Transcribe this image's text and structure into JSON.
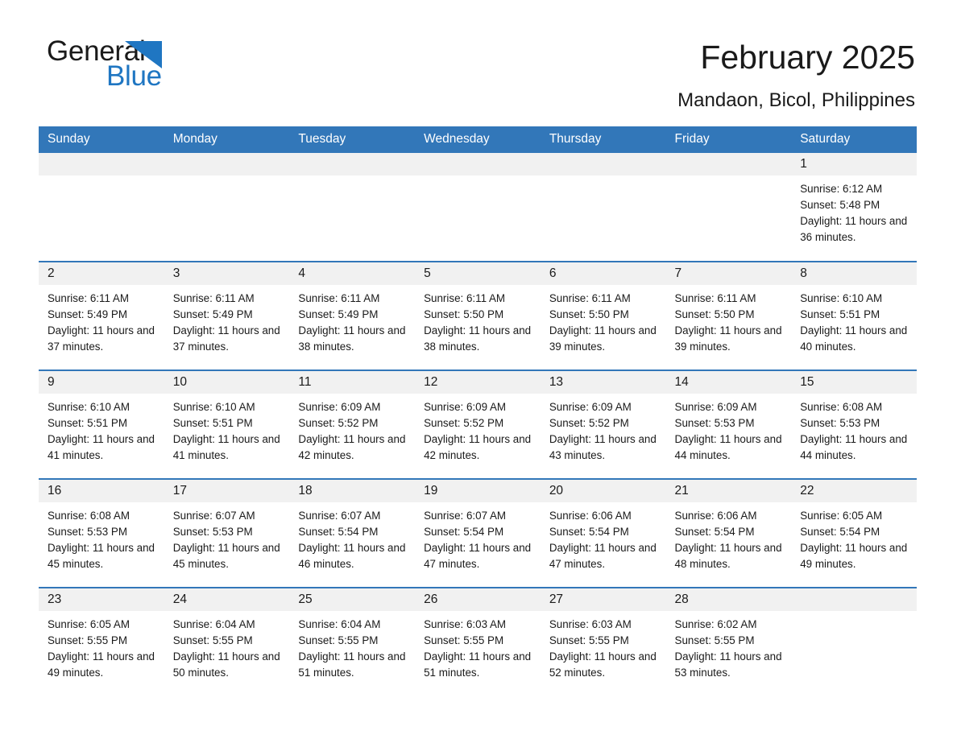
{
  "brand": {
    "name_part1": "General",
    "name_part2": "Blue",
    "logo_icon": "triangle-flag-icon",
    "accent_color": "#1f76c2"
  },
  "header": {
    "title": "February 2025",
    "subtitle": "Mandaon, Bicol, Philippines"
  },
  "theme": {
    "header_blue": "#3277b9",
    "daynum_band": "#f1f1f1",
    "text": "#1a1a1a"
  },
  "calendar": {
    "weekday_headers": [
      "Sunday",
      "Monday",
      "Tuesday",
      "Wednesday",
      "Thursday",
      "Friday",
      "Saturday"
    ],
    "weeks": [
      [
        {
          "day": "",
          "empty": true,
          "sunrise": "",
          "sunset": "",
          "daylight": ""
        },
        {
          "day": "",
          "empty": true,
          "sunrise": "",
          "sunset": "",
          "daylight": ""
        },
        {
          "day": "",
          "empty": true,
          "sunrise": "",
          "sunset": "",
          "daylight": ""
        },
        {
          "day": "",
          "empty": true,
          "sunrise": "",
          "sunset": "",
          "daylight": ""
        },
        {
          "day": "",
          "empty": true,
          "sunrise": "",
          "sunset": "",
          "daylight": ""
        },
        {
          "day": "",
          "empty": true,
          "sunrise": "",
          "sunset": "",
          "daylight": ""
        },
        {
          "day": "1",
          "empty": false,
          "sunrise": "Sunrise: 6:12 AM",
          "sunset": "Sunset: 5:48 PM",
          "daylight": "Daylight: 11 hours and 36 minutes."
        }
      ],
      [
        {
          "day": "2",
          "empty": false,
          "sunrise": "Sunrise: 6:11 AM",
          "sunset": "Sunset: 5:49 PM",
          "daylight": "Daylight: 11 hours and 37 minutes."
        },
        {
          "day": "3",
          "empty": false,
          "sunrise": "Sunrise: 6:11 AM",
          "sunset": "Sunset: 5:49 PM",
          "daylight": "Daylight: 11 hours and 37 minutes."
        },
        {
          "day": "4",
          "empty": false,
          "sunrise": "Sunrise: 6:11 AM",
          "sunset": "Sunset: 5:49 PM",
          "daylight": "Daylight: 11 hours and 38 minutes."
        },
        {
          "day": "5",
          "empty": false,
          "sunrise": "Sunrise: 6:11 AM",
          "sunset": "Sunset: 5:50 PM",
          "daylight": "Daylight: 11 hours and 38 minutes."
        },
        {
          "day": "6",
          "empty": false,
          "sunrise": "Sunrise: 6:11 AM",
          "sunset": "Sunset: 5:50 PM",
          "daylight": "Daylight: 11 hours and 39 minutes."
        },
        {
          "day": "7",
          "empty": false,
          "sunrise": "Sunrise: 6:11 AM",
          "sunset": "Sunset: 5:50 PM",
          "daylight": "Daylight: 11 hours and 39 minutes."
        },
        {
          "day": "8",
          "empty": false,
          "sunrise": "Sunrise: 6:10 AM",
          "sunset": "Sunset: 5:51 PM",
          "daylight": "Daylight: 11 hours and 40 minutes."
        }
      ],
      [
        {
          "day": "9",
          "empty": false,
          "sunrise": "Sunrise: 6:10 AM",
          "sunset": "Sunset: 5:51 PM",
          "daylight": "Daylight: 11 hours and 41 minutes."
        },
        {
          "day": "10",
          "empty": false,
          "sunrise": "Sunrise: 6:10 AM",
          "sunset": "Sunset: 5:51 PM",
          "daylight": "Daylight: 11 hours and 41 minutes."
        },
        {
          "day": "11",
          "empty": false,
          "sunrise": "Sunrise: 6:09 AM",
          "sunset": "Sunset: 5:52 PM",
          "daylight": "Daylight: 11 hours and 42 minutes."
        },
        {
          "day": "12",
          "empty": false,
          "sunrise": "Sunrise: 6:09 AM",
          "sunset": "Sunset: 5:52 PM",
          "daylight": "Daylight: 11 hours and 42 minutes."
        },
        {
          "day": "13",
          "empty": false,
          "sunrise": "Sunrise: 6:09 AM",
          "sunset": "Sunset: 5:52 PM",
          "daylight": "Daylight: 11 hours and 43 minutes."
        },
        {
          "day": "14",
          "empty": false,
          "sunrise": "Sunrise: 6:09 AM",
          "sunset": "Sunset: 5:53 PM",
          "daylight": "Daylight: 11 hours and 44 minutes."
        },
        {
          "day": "15",
          "empty": false,
          "sunrise": "Sunrise: 6:08 AM",
          "sunset": "Sunset: 5:53 PM",
          "daylight": "Daylight: 11 hours and 44 minutes."
        }
      ],
      [
        {
          "day": "16",
          "empty": false,
          "sunrise": "Sunrise: 6:08 AM",
          "sunset": "Sunset: 5:53 PM",
          "daylight": "Daylight: 11 hours and 45 minutes."
        },
        {
          "day": "17",
          "empty": false,
          "sunrise": "Sunrise: 6:07 AM",
          "sunset": "Sunset: 5:53 PM",
          "daylight": "Daylight: 11 hours and 45 minutes."
        },
        {
          "day": "18",
          "empty": false,
          "sunrise": "Sunrise: 6:07 AM",
          "sunset": "Sunset: 5:54 PM",
          "daylight": "Daylight: 11 hours and 46 minutes."
        },
        {
          "day": "19",
          "empty": false,
          "sunrise": "Sunrise: 6:07 AM",
          "sunset": "Sunset: 5:54 PM",
          "daylight": "Daylight: 11 hours and 47 minutes."
        },
        {
          "day": "20",
          "empty": false,
          "sunrise": "Sunrise: 6:06 AM",
          "sunset": "Sunset: 5:54 PM",
          "daylight": "Daylight: 11 hours and 47 minutes."
        },
        {
          "day": "21",
          "empty": false,
          "sunrise": "Sunrise: 6:06 AM",
          "sunset": "Sunset: 5:54 PM",
          "daylight": "Daylight: 11 hours and 48 minutes."
        },
        {
          "day": "22",
          "empty": false,
          "sunrise": "Sunrise: 6:05 AM",
          "sunset": "Sunset: 5:54 PM",
          "daylight": "Daylight: 11 hours and 49 minutes."
        }
      ],
      [
        {
          "day": "23",
          "empty": false,
          "sunrise": "Sunrise: 6:05 AM",
          "sunset": "Sunset: 5:55 PM",
          "daylight": "Daylight: 11 hours and 49 minutes."
        },
        {
          "day": "24",
          "empty": false,
          "sunrise": "Sunrise: 6:04 AM",
          "sunset": "Sunset: 5:55 PM",
          "daylight": "Daylight: 11 hours and 50 minutes."
        },
        {
          "day": "25",
          "empty": false,
          "sunrise": "Sunrise: 6:04 AM",
          "sunset": "Sunset: 5:55 PM",
          "daylight": "Daylight: 11 hours and 51 minutes."
        },
        {
          "day": "26",
          "empty": false,
          "sunrise": "Sunrise: 6:03 AM",
          "sunset": "Sunset: 5:55 PM",
          "daylight": "Daylight: 11 hours and 51 minutes."
        },
        {
          "day": "27",
          "empty": false,
          "sunrise": "Sunrise: 6:03 AM",
          "sunset": "Sunset: 5:55 PM",
          "daylight": "Daylight: 11 hours and 52 minutes."
        },
        {
          "day": "28",
          "empty": false,
          "sunrise": "Sunrise: 6:02 AM",
          "sunset": "Sunset: 5:55 PM",
          "daylight": "Daylight: 11 hours and 53 minutes."
        },
        {
          "day": "",
          "empty": true,
          "sunrise": "",
          "sunset": "",
          "daylight": ""
        }
      ]
    ]
  }
}
